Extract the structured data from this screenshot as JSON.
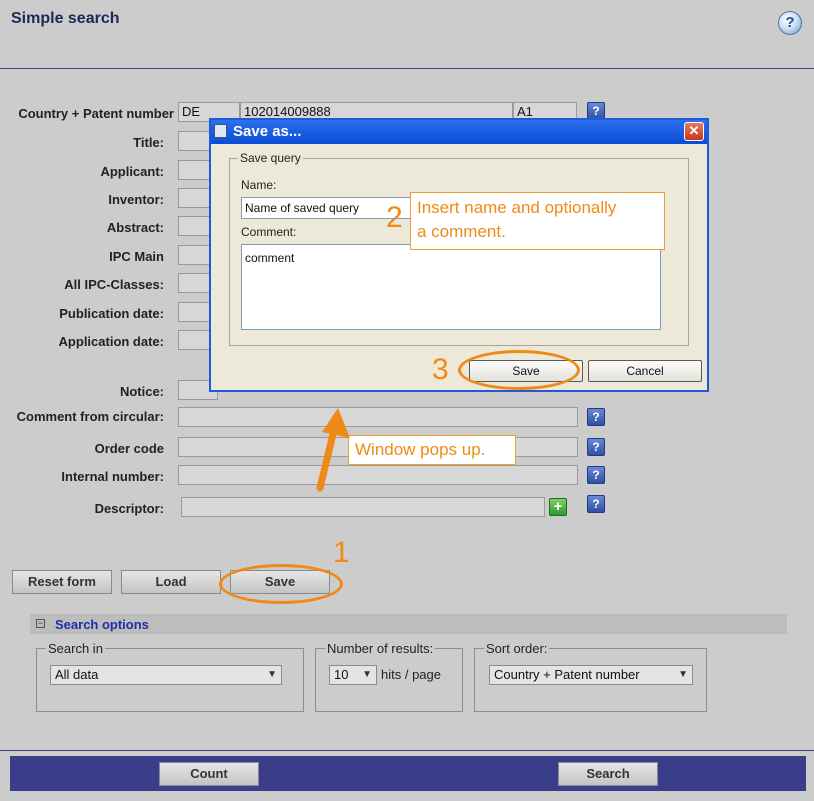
{
  "page": {
    "title": "Simple search",
    "help_glyph": "?"
  },
  "form": {
    "country_patent": {
      "label": "Country + Patent number",
      "country": "DE",
      "number": "102014009888",
      "kind": "A1"
    },
    "fields": [
      {
        "label": "Title:",
        "value": ""
      },
      {
        "label": "Applicant:",
        "value": ""
      },
      {
        "label": "Inventor:",
        "value": ""
      },
      {
        "label": "Abstract:",
        "value": ""
      },
      {
        "label": "IPC Main",
        "value": ""
      },
      {
        "label": "All IPC-Classes:",
        "value": ""
      },
      {
        "label": "Publication date:",
        "value": ""
      },
      {
        "label": "Application date:",
        "value": ""
      },
      {
        "label": "Notice:",
        "value": ""
      },
      {
        "label": "Comment from circular:",
        "value": ""
      },
      {
        "label": "Order code",
        "value": ""
      },
      {
        "label": "Internal number:",
        "value": ""
      },
      {
        "label": "Descriptor:",
        "value": ""
      }
    ],
    "help_glyph": "?",
    "plus_glyph": "+"
  },
  "actions": {
    "reset": "Reset form",
    "load": "Load",
    "save": "Save"
  },
  "search_options": {
    "title": "Search options",
    "toggle_glyph": "−",
    "search_in": {
      "legend": "Search in",
      "selected": "All data"
    },
    "results": {
      "legend": "Number of results:",
      "selected": "10",
      "suffix": "hits / page"
    },
    "sort": {
      "legend": "Sort order:",
      "selected": "Country + Patent number"
    }
  },
  "bottom": {
    "count": "Count",
    "search": "Search"
  },
  "dialog": {
    "title": "Save as...",
    "close_glyph": "✕",
    "group_legend": "Save query",
    "name_label": "Name:",
    "name_value": "Name of saved query",
    "comment_label": "Comment:",
    "comment_value": "comment",
    "save": "Save",
    "cancel": "Cancel"
  },
  "annotations": {
    "step1": "1",
    "step2": "2",
    "step3": "3",
    "callout_popup": "Window pops up.",
    "callout_name_line1": "Insert name and optionally",
    "callout_name_line2": "a comment.",
    "color": "#f08a16"
  }
}
